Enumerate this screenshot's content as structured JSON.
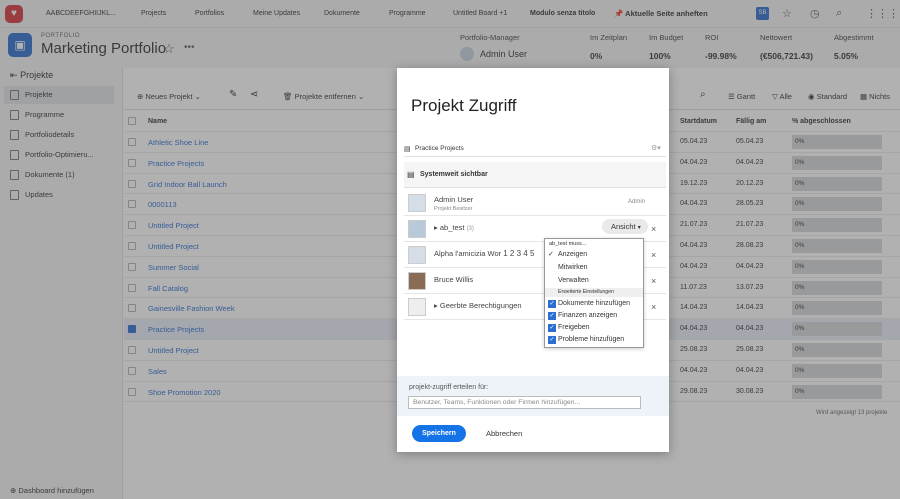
{
  "topnav": {
    "logo": "♥",
    "items": [
      "AABCDEEFGHIIJKL...",
      "Projects",
      "Portfolios",
      "Meine Updates",
      "Dokumente",
      "Programme",
      "Untitled Board +1",
      "Modulo senza titolo"
    ],
    "pin_label": "Aktuelle Seite anheften",
    "badge": "SB"
  },
  "header": {
    "label": "PORTFOLIO",
    "title": "Marketing Portfolio",
    "dots": "•••",
    "manager_label": "Portfolio-Manager",
    "manager_name": "Admin User",
    "metrics": [
      {
        "label": "Im Zeitplan",
        "value": "0%"
      },
      {
        "label": "Im Budget",
        "value": "100%"
      },
      {
        "label": "ROI",
        "value": "-99.98%"
      },
      {
        "label": "Nettowert",
        "value": "(€506,721.43)"
      },
      {
        "label": "Abgestimmt",
        "value": "5.05%"
      }
    ]
  },
  "sidebar": {
    "heading": "Projekte",
    "items": [
      "Projekte",
      "Programme",
      "Portfoliodetails",
      "Portfolio-Optimieru...",
      "Dokumente (1)",
      "Updates"
    ],
    "footer": "Dashboard hinzufügen"
  },
  "toolbar": {
    "new_project": "Neues Projekt",
    "remove_projects": "Projekte entfernen",
    "gantt": "Gantt",
    "all": "Alle",
    "standard": "Standard",
    "none": "Nichts"
  },
  "grid": {
    "headers": {
      "name": "Name",
      "start": "Startdatum",
      "due": "Fällig am",
      "pct": "% abgeschlossen"
    },
    "rows": [
      {
        "name": "Athletic Shoe Line",
        "start": "05.04.23",
        "due": "05.04.23",
        "pct": "0%"
      },
      {
        "name": "Practice Projects",
        "start": "04.04.23",
        "due": "04.04.23",
        "pct": "0%"
      },
      {
        "name": "Grid Indoor Ball Launch",
        "start": "19.12.23",
        "due": "20.12.23",
        "pct": "0%"
      },
      {
        "name": "0000113",
        "start": "04.04.23",
        "due": "28.05.23",
        "pct": "0%"
      },
      {
        "name": "Untitled Project",
        "start": "21.07.23",
        "due": "21.07.23",
        "pct": "0%"
      },
      {
        "name": "Untitled Project",
        "start": "04.04.23",
        "due": "28.08.23",
        "pct": "0%"
      },
      {
        "name": "Summer Social",
        "start": "04.04.23",
        "due": "04.04.23",
        "pct": "0%"
      },
      {
        "name": "Fall Catalog",
        "start": "11.07.23",
        "due": "13.07.23",
        "pct": "0%"
      },
      {
        "name": "Gainesville Fashion Week",
        "start": "14.04.23",
        "due": "14.04.23",
        "pct": "0%"
      },
      {
        "name": "Practice Projects",
        "start": "04.04.23",
        "due": "04.04.23",
        "pct": "0%",
        "selected": true
      },
      {
        "name": "Untitled Project",
        "start": "25.08.23",
        "due": "25.08.23",
        "pct": "0%"
      },
      {
        "name": "Sales",
        "start": "04.04.23",
        "due": "04.04.23",
        "pct": "0%"
      },
      {
        "name": "Shoe Promotion 2020",
        "start": "29.08.23",
        "due": "30.08.23",
        "pct": "0%"
      }
    ],
    "footer": "Wird angezeigt 13 projekte"
  },
  "modal": {
    "title": "Projekt Zugriff",
    "project_name": "Practice Projects",
    "system_visible": "Systemweit sichtbar",
    "users": [
      {
        "name": "Admin User",
        "role": "Projekt Besitzer",
        "badge": "Admin"
      },
      {
        "name": "ab_test",
        "count": "(3)",
        "access": "Ansicht"
      },
      {
        "name": "Alpha l'amicizia Wor",
        "extra": "1 2 3 4 5"
      },
      {
        "name": "Bruce Willis"
      },
      {
        "name": "Geerbte Berechtigungen"
      }
    ],
    "share_label": "projekt-zugriff erteilen für:",
    "share_placeholder": "Benutzer, Teams, Funktionen oder Firmen hinzufügen...",
    "save": "Speichern",
    "cancel": "Abbrechen"
  },
  "dropdown": {
    "heading": "ab_test muss...",
    "options": [
      "Anzeigen",
      "Mitwirken",
      "Verwalten"
    ],
    "advanced": "Erweiterte Einstellungen",
    "checks": [
      "Dokumente hinzufügen",
      "Finanzen anzeigen",
      "Freigeben",
      "Probleme hinzufügen"
    ]
  }
}
